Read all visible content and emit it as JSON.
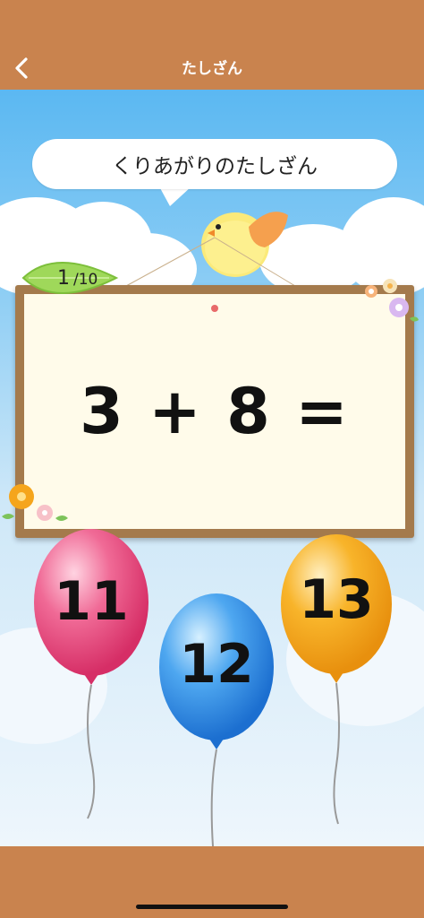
{
  "header": {
    "title": "たしざん",
    "back_icon": "chevron-left-icon"
  },
  "prompt": {
    "text": "くりあがりのたしざん"
  },
  "progress": {
    "current": "1",
    "total": "/10"
  },
  "question": {
    "equation": "3 + 8 ="
  },
  "answers": [
    {
      "label": "11",
      "color": "#E8457A"
    },
    {
      "label": "12",
      "color": "#2E8FE8"
    },
    {
      "label": "13",
      "color": "#F5A51C"
    }
  ],
  "colors": {
    "header": "#C9834E",
    "board_frame": "#A47A4C",
    "board": "#FFFBEA"
  }
}
